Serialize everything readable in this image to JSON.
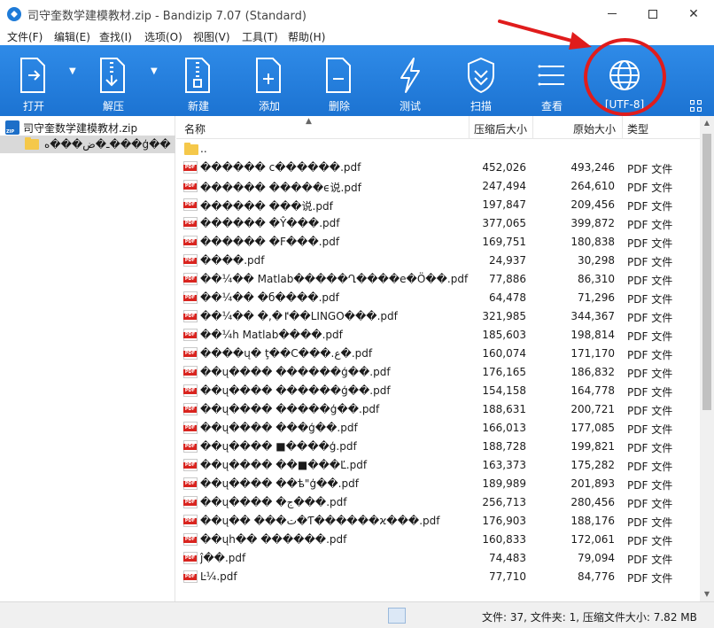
{
  "window": {
    "title": "司守奎数学建模教材.zip - Bandizip 7.07 (Standard)",
    "minimize": "—",
    "maximize": "☐",
    "close": "✕"
  },
  "menu": [
    "文件(F)",
    "编辑(E)",
    "查找(I)",
    "选项(O)",
    "视图(V)",
    "工具(T)",
    "帮助(H)"
  ],
  "toolbar": {
    "open": "打开",
    "extract": "解压",
    "new": "新建",
    "add": "添加",
    "delete": "删除",
    "test": "测试",
    "scan": "扫描",
    "view": "查看",
    "encoding": "[UTF-8]"
  },
  "tree": {
    "root": "司守奎数学建模教材.zip",
    "child": "ـ�ض���ﻩ���ģ��"
  },
  "columns": {
    "name": "名称",
    "compressed": "压缩后大小",
    "original": "原始大小",
    "type": "类型"
  },
  "parent_row": "..",
  "files": [
    {
      "name": "������  c������.pdf",
      "csize": "452,026",
      "osize": "493,246",
      "type": "PDF 文件"
    },
    {
      "name": "������  �����ϵ说.pdf",
      "csize": "247,494",
      "osize": "264,610",
      "type": "PDF 文件"
    },
    {
      "name": "������  ���说.pdf",
      "csize": "197,847",
      "osize": "209,456",
      "type": "PDF 文件"
    },
    {
      "name": "������ �Ŷ���.pdf",
      "csize": "377,065",
      "osize": "399,872",
      "type": "PDF 文件"
    },
    {
      "name": "������ �Ϝ���.pdf",
      "csize": "169,751",
      "osize": "180,838",
      "type": "PDF 文件"
    },
    {
      "name": "����.pdf",
      "csize": "24,937",
      "osize": "30,298",
      "type": "PDF 文件"
    },
    {
      "name": "��¼��  Matlab�����Ղ����e�Ö��.pdf",
      "csize": "77,886",
      "osize": "86,310",
      "type": "PDF 文件"
    },
    {
      "name": "��¼��  �б����.pdf",
      "csize": "64,478",
      "osize": "71,296",
      "type": "PDF 文件"
    },
    {
      "name": "��¼��  �,�ٵ��LINGO���.pdf",
      "csize": "321,985",
      "osize": "344,367",
      "type": "PDF 文件"
    },
    {
      "name": "��¼h  Matlab����.pdf",
      "csize": "185,603",
      "osize": "198,814",
      "type": "PDF 文件"
    },
    {
      "name": "����ų�  ţ��C���.ع�.pdf",
      "csize": "160,074",
      "osize": "171,170",
      "type": "PDF 文件"
    },
    {
      "name": "��ų����  ������ģ��.pdf",
      "csize": "176,165",
      "osize": "186,832",
      "type": "PDF 文件"
    },
    {
      "name": "��ų����  ������ģ��.pdf",
      "csize": "154,158",
      "osize": "164,778",
      "type": "PDF 文件"
    },
    {
      "name": "��ų����  �����ģ��.pdf",
      "csize": "188,631",
      "osize": "200,721",
      "type": "PDF 文件"
    },
    {
      "name": "��ų����  ���ģ��.pdf",
      "csize": "166,013",
      "osize": "177,085",
      "type": "PDF 文件"
    },
    {
      "name": "��ų����  ■����ģ.pdf",
      "csize": "188,728",
      "osize": "199,821",
      "type": "PDF 文件"
    },
    {
      "name": "��ų����  ��■���Ľ.pdf",
      "csize": "163,373",
      "osize": "175,282",
      "type": "PDF 文件"
    },
    {
      "name": "��ų����  ��ѣ\"ģ��.pdf",
      "csize": "189,989",
      "osize": "201,893",
      "type": "PDF 文件"
    },
    {
      "name": "��ų����  �ج���.pdf",
      "csize": "256,713",
      "osize": "280,456",
      "type": "PDF 文件"
    },
    {
      "name": "��ų��  ���ت�Ƭ������ϰ���.pdf",
      "csize": "176,903",
      "osize": "188,176",
      "type": "PDF 文件"
    },
    {
      "name": "��ųh��  ������.pdf",
      "csize": "160,833",
      "osize": "172,061",
      "type": "PDF 文件"
    },
    {
      "name": "ĵ��.pdf",
      "csize": "74,483",
      "osize": "79,094",
      "type": "PDF 文件"
    },
    {
      "name": "Ŀ¼.pdf",
      "csize": "77,710",
      "osize": "84,776",
      "type": "PDF 文件"
    }
  ],
  "status": "文件: 37, 文件夹: 1, 压缩文件大小: 7.82 MB",
  "icons": {
    "open": "open-archive-icon",
    "extract": "extract-icon",
    "new": "new-archive-icon",
    "add": "add-file-icon",
    "delete": "delete-file-icon",
    "test": "lightning-icon",
    "scan": "shield-check-icon",
    "view": "list-view-icon",
    "encoding": "globe-icon"
  },
  "colors": {
    "toolbar_top": "#2f8be8",
    "toolbar_bottom": "#1c73d2",
    "annotation": "#e01c1c",
    "selected_row": "#d9d9d9",
    "pdf_badge": "#d9241f"
  }
}
